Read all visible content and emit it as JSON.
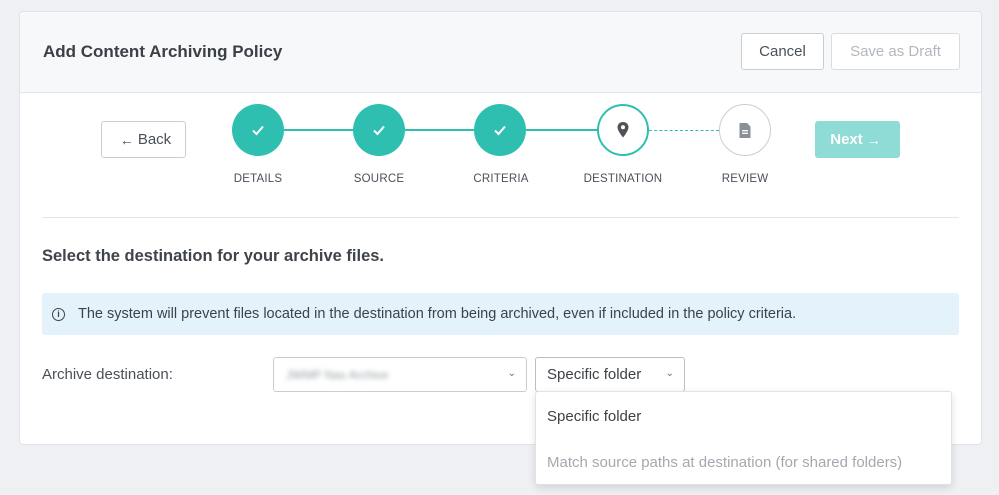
{
  "header": {
    "title": "Add Content Archiving Policy",
    "cancel_label": "Cancel",
    "save_draft_label": "Save as Draft"
  },
  "wizard": {
    "back_label": "Back",
    "next_label": "Next",
    "steps": [
      {
        "label": "DETAILS",
        "state": "done",
        "icon": "check-icon"
      },
      {
        "label": "SOURCE",
        "state": "done",
        "icon": "check-icon"
      },
      {
        "label": "CRITERIA",
        "state": "done",
        "icon": "check-icon"
      },
      {
        "label": "DESTINATION",
        "state": "current",
        "icon": "map-pin-icon"
      },
      {
        "label": "REVIEW",
        "state": "future",
        "icon": "document-icon"
      }
    ]
  },
  "main": {
    "section_title": "Select the destination for your archive files.",
    "info_message": "The system will prevent files located in the destination from being archived, even if included in the policy criteria.",
    "destination_label": "Archive destination:",
    "destination_value": "JWMP Nas Archive",
    "type_selected": "Specific folder",
    "type_options": [
      {
        "label": "Specific folder",
        "enabled": true
      },
      {
        "label": "Match source paths at destination (for shared folders)",
        "enabled": false
      }
    ]
  },
  "colors": {
    "accent": "#2ebfb0",
    "next_disabled": "#8fdcd6",
    "info_bg": "#e4f2fb"
  }
}
